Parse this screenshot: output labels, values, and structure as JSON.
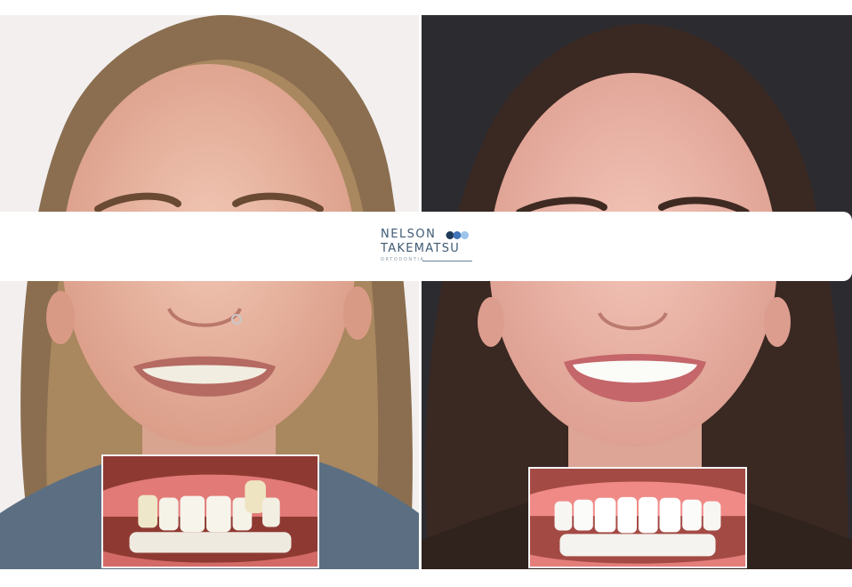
{
  "photos": {
    "before": {
      "label": ""
    },
    "after": {
      "label": ""
    }
  },
  "logo": {
    "line1": "NELSON",
    "line2": "TAKEMATSU",
    "line3": "ORTODONTIA",
    "colors": {
      "text": "#3e5a73",
      "dot_dark": "#203a5a",
      "dot_mid": "#3f74b8",
      "dot_light": "#9cc3ea"
    }
  }
}
